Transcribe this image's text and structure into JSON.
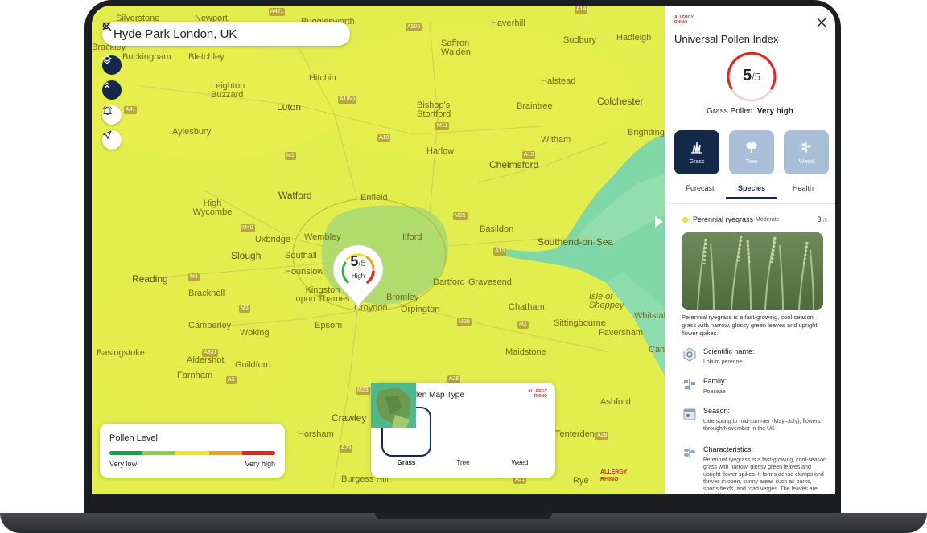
{
  "search": {
    "query": "Hyde Park London, UK"
  },
  "map": {
    "places": [
      "Silverstone",
      "Newport",
      "Bugglesworth",
      "Haverhill",
      "Sudbury",
      "Hadleigh",
      "Brackley",
      "Buckingham",
      "Bletchley",
      "Saffron Walden",
      "Halstead",
      "Hitchin",
      "Leighton Buzzard",
      "Luton",
      "Bishop's Stortford",
      "Braintree",
      "Colchester",
      "Aylesbury",
      "Witham",
      "Brightling",
      "Harlow",
      "Chelmsford",
      "Watford",
      "Enfield",
      "High Wycombe",
      "Basildon",
      "Uxbridge",
      "Wembley",
      "Ilford",
      "Southend-on-Sea",
      "Slough",
      "Southall",
      "Reading",
      "Hounslow",
      "Bracknell",
      "Kingston upon Thames",
      "Bromley",
      "Croydon",
      "Dartford",
      "Gravesend",
      "Isle of Sheppey",
      "Orpington",
      "Chatham",
      "Whitstab",
      "Camberley",
      "Epsom",
      "Sittingbourne",
      "Faversham",
      "Woking",
      "Basingstoke",
      "Aldershot",
      "Guildford",
      "Maidstone",
      "Cant",
      "Farnham",
      "Ashford",
      "Crawley",
      "Horsham",
      "Tenterden",
      "Burgess Hill",
      "Rye"
    ],
    "roads": [
      "A421",
      "A505",
      "A14",
      "A41",
      "A1(M)",
      "M11",
      "A10",
      "A12",
      "M1",
      "M40",
      "M25",
      "A13",
      "M4",
      "M3",
      "M20",
      "M2",
      "A331",
      "A3",
      "M23",
      "A23",
      "A28",
      "A21",
      "A26"
    ]
  },
  "marker": {
    "score": "5",
    "max": "/5",
    "level": "High"
  },
  "legend": {
    "title": "Pollen Level",
    "low_label": "Very low",
    "high_label": "Very high",
    "colors": [
      "#12a34a",
      "#8fcf3d",
      "#f0e716",
      "#f7a21b",
      "#e8231d"
    ]
  },
  "map_type": {
    "title": "Plant Pollen Map Type",
    "logo": "ALLERGY RHINO",
    "options": [
      {
        "label": "Grass",
        "selected": true
      },
      {
        "label": "Tree",
        "selected": false
      },
      {
        "label": "Weed",
        "selected": false
      }
    ]
  },
  "watermark": "ALLERGY RHINO",
  "panel": {
    "logo": "ALLERGY RHINO",
    "title": "Universal Pollen Index",
    "score": "5",
    "max": "/5",
    "status_prefix": "Grass Pollen: ",
    "status_value": "Very high",
    "types": [
      {
        "label": "Grass",
        "icon": "grass-icon",
        "active": true
      },
      {
        "label": "Tree",
        "icon": "tree-icon",
        "active": false
      },
      {
        "label": "Weed",
        "icon": "weed-icon",
        "active": false
      }
    ],
    "tabs": [
      {
        "label": "Forecast",
        "active": false
      },
      {
        "label": "Species",
        "active": true
      },
      {
        "label": "Health",
        "active": false
      }
    ],
    "species": {
      "name": "Perennial ryegrass",
      "level": "Moderate",
      "score": "3",
      "max": "/5",
      "description": "Perennial ryegrass is a fast-growing, cool-season grass with narrow, glossy green leaves and upright flower spikes.",
      "scientific_label": "Scientific name:",
      "scientific_value": "Lolium perenne",
      "family_label": "Family:",
      "family_value": "Poaceae",
      "season_label": "Season:",
      "season_value": "Late spring to mid-summer (May–July), flowers through November in the UK",
      "characteristics_label": "Characteristics:",
      "characteristics_value": "Perennial ryegrass is a fast-growing, cool-season grass with narrow, glossy green leaves and upright flower spikes. It forms dense clumps and thrives in open, sunny areas such as parks, sports fields, and road verges. The leaves are folded in"
    }
  }
}
